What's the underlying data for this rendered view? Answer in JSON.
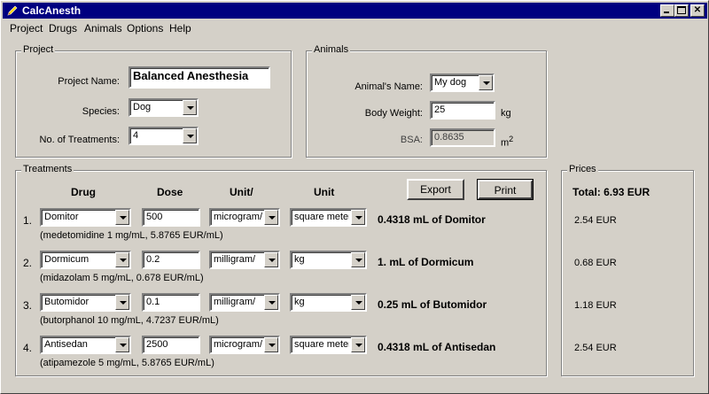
{
  "window": {
    "title": "CalcAnesth"
  },
  "menu": [
    "Project",
    "Drugs",
    "Animals",
    "Options",
    "Help"
  ],
  "project": {
    "group_label": "Project",
    "name_label": "Project Name:",
    "name_value": "Balanced Anesthesia",
    "species_label": "Species:",
    "species_value": "Dog",
    "treatments_label": "No. of Treatments:",
    "treatments_value": "4"
  },
  "animals": {
    "group_label": "Animals",
    "name_label": "Animal's Name:",
    "name_value": "My dog",
    "weight_label": "Body Weight:",
    "weight_value": "25",
    "weight_unit": "kg",
    "bsa_label": "BSA:",
    "bsa_value": "0.8635",
    "bsa_unit": "m",
    "bsa_unit_sup": "2"
  },
  "treatments": {
    "group_label": "Treatments",
    "headers": {
      "drug": "Drug",
      "dose": "Dose",
      "unit1": "Unit/",
      "unit2": "Unit"
    },
    "export_label": "Export",
    "print_label": "Print",
    "rows": [
      {
        "num": "1.",
        "drug": "Domitor",
        "dose": "500",
        "unit1": "microgram/",
        "unit2": "square meter",
        "result": "0.4318 mL of Domitor",
        "info": "(medetomidine 1 mg/mL, 5.8765 EUR/mL)"
      },
      {
        "num": "2.",
        "drug": "Dormicum",
        "dose": "0.2",
        "unit1": "milligram/",
        "unit2": "kg",
        "result": "1. mL of Dormicum",
        "info": "(midazolam 5 mg/mL, 0.678 EUR/mL)"
      },
      {
        "num": "3.",
        "drug": "Butomidor",
        "dose": "0.1",
        "unit1": "milligram/",
        "unit2": "kg",
        "result": "0.25 mL of Butomidor",
        "info": "(butorphanol 10 mg/mL, 4.7237 EUR/mL)"
      },
      {
        "num": "4.",
        "drug": "Antisedan",
        "dose": "2500",
        "unit1": "microgram/",
        "unit2": "square meter",
        "result": "0.4318 mL of Antisedan",
        "info": "(atipamezole 5 mg/mL, 5.8765 EUR/mL)"
      }
    ]
  },
  "prices": {
    "group_label": "Prices",
    "total": "Total: 6.93 EUR",
    "items": [
      "2.54 EUR",
      "0.68 EUR",
      "1.18 EUR",
      "2.54 EUR"
    ]
  }
}
